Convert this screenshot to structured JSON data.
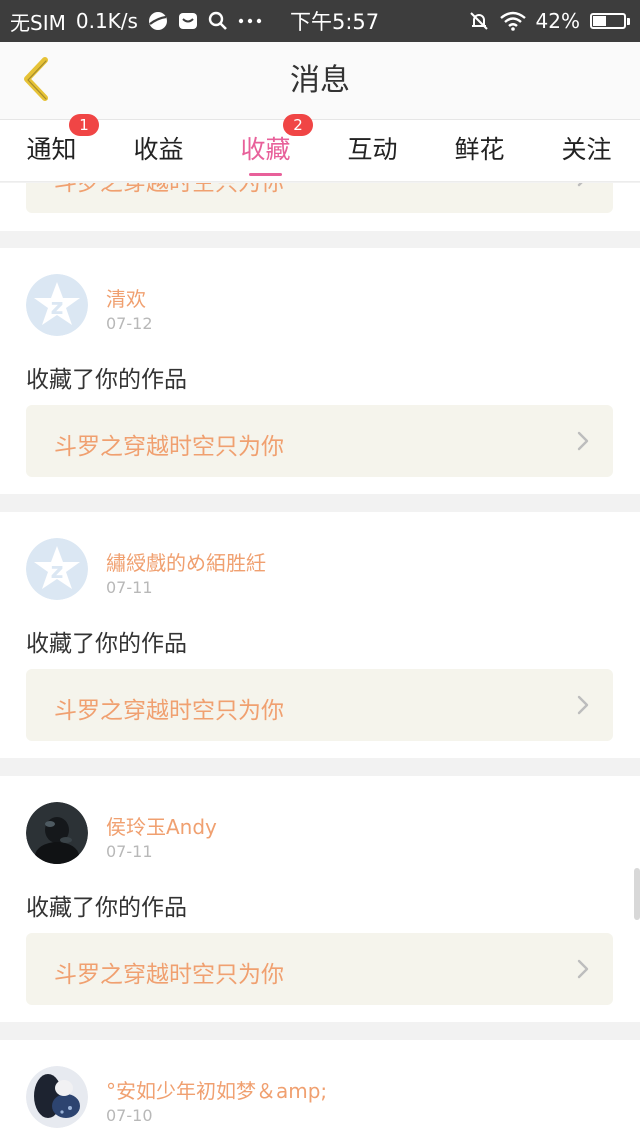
{
  "status_bar": {
    "carrier": "无SIM",
    "speed": "0.1K/s",
    "time": "下午5:57",
    "battery_text": "42%",
    "battery_level": 0.42,
    "icons": [
      "browser-icon",
      "message-icon",
      "search-icon",
      "more-icon",
      "alarm-off-icon",
      "wifi-icon",
      "battery-icon"
    ]
  },
  "nav": {
    "title": "消息",
    "back_icon": "chevron-left-icon"
  },
  "tabs": [
    {
      "label": "通知",
      "badge": "1",
      "active": false
    },
    {
      "label": "收益",
      "badge": "",
      "active": false
    },
    {
      "label": "收藏",
      "badge": "2",
      "active": true
    },
    {
      "label": "互动",
      "badge": "",
      "active": false
    },
    {
      "label": "鲜花",
      "badge": "",
      "active": false
    },
    {
      "label": "关注",
      "badge": "",
      "active": false
    }
  ],
  "partial_card": {
    "work_title": "斗罗之穿越时空只为你"
  },
  "items": [
    {
      "user": "清欢",
      "date": "07-12",
      "action": "收藏了你的作品",
      "work_title": "斗罗之穿越时空只为你",
      "avatar": "default"
    },
    {
      "user": "繡綬戲的め絔胜紝",
      "date": "07-11",
      "action": "收藏了你的作品",
      "work_title": "斗罗之穿越时空只为你",
      "avatar": "default"
    },
    {
      "user": "侯玲玉Andy",
      "date": "07-11",
      "action": "收藏了你的作品",
      "work_title": "斗罗之穿越时空只为你",
      "avatar": "photo-dark"
    },
    {
      "user": "°安如少年初如梦＆amp;",
      "date": "07-10",
      "action": "",
      "work_title": "",
      "avatar": "photo-blue"
    }
  ],
  "colors": {
    "accent": "#e8609a",
    "badge": "#f04545",
    "username": "#f0a070",
    "work_title": "#f0a070",
    "work_bg": "#f5f4ec",
    "back_icon": "#e6c236"
  }
}
